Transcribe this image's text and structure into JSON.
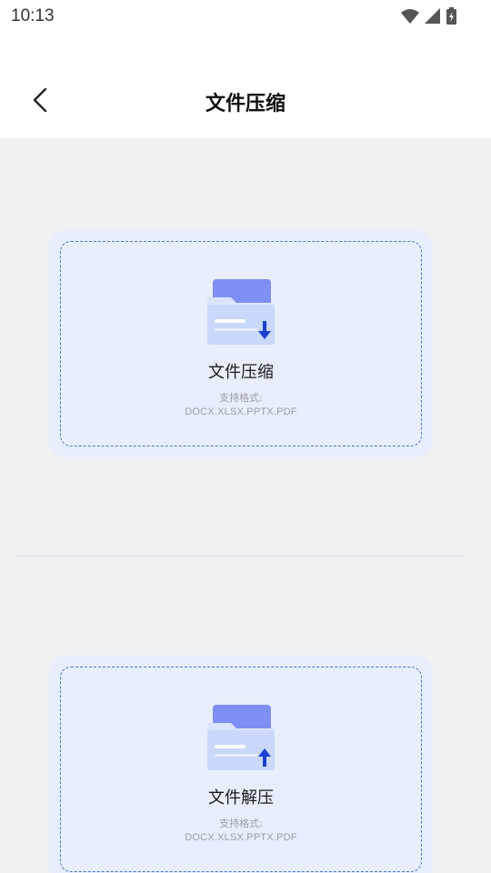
{
  "status_bar": {
    "time": "10:13",
    "icons": [
      "wifi-icon",
      "signal-icon",
      "battery-charging-icon"
    ]
  },
  "header": {
    "back_icon": "chevron-left-icon",
    "title": "文件压缩"
  },
  "cards": [
    {
      "title": "文件压缩",
      "support_label": "支持格式:",
      "formats": "DOCX.XLSX.PPTX.PDF",
      "icon": "folder-download-icon"
    },
    {
      "title": "文件解压",
      "support_label": "支持格式:",
      "formats": "DOCX.XLSX.PPTX.PDF",
      "icon": "folder-upload-icon"
    }
  ],
  "colors": {
    "accent": "#1a3fd1",
    "folder_back": "#7f8ff4",
    "card_bg": "#e8eefb",
    "dash_border": "#4a78d0",
    "page_bg": "#f0f1f3"
  }
}
